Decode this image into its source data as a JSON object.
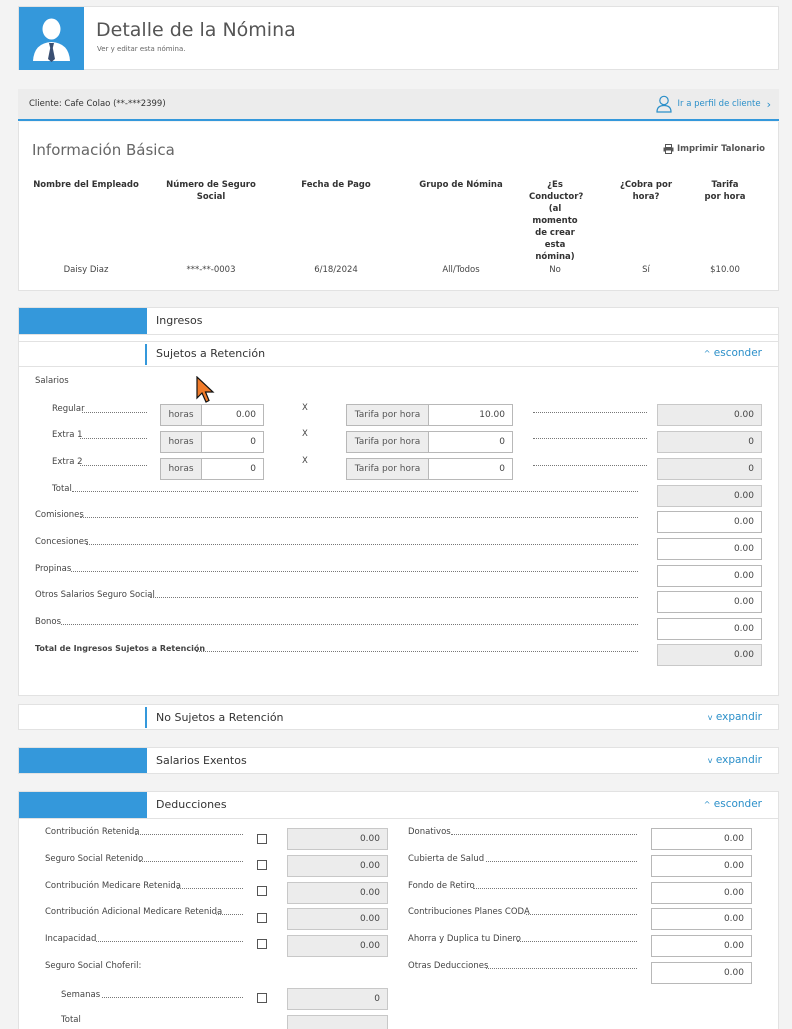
{
  "header": {
    "title": "Detalle de la Nómina",
    "subtitle": "Ver y editar esta nómina."
  },
  "client_bar": {
    "client_label": "Cliente: Cafe Colao (**-***2399)",
    "profile_link": "Ir a perfil de cliente"
  },
  "basic_info": {
    "title": "Información Básica",
    "print_label": "Imprimir Talonario",
    "columns": [
      "Nombre del Empleado",
      "Número de Seguro Social",
      "Fecha de Pago",
      "Grupo de Nómina",
      "¿Es Conductor? (al momento de crear esta nómina)",
      "¿Cobra por hora?",
      "Tarifa por hora"
    ],
    "row": [
      "Daisy Diaz",
      "***-**-0003",
      "6/18/2024",
      "All/Todos",
      "No",
      "Sí",
      "$10.00"
    ]
  },
  "sections": {
    "ingresos": "Ingresos",
    "sujetos": "Sujetos a Retención",
    "no_sujetos": "No Sujetos a Retención",
    "exentos": "Salarios Exentos",
    "deducciones": "Deducciones",
    "hide": "esconder",
    "expand": "expandir"
  },
  "salarios": {
    "label": "Salarios",
    "x": "X",
    "hours_addon": "horas",
    "rate_addon": "Tarifa por hora",
    "rows": [
      {
        "label": "Regular",
        "hours": "0.00",
        "rate": "10.00",
        "total": "0.00"
      },
      {
        "label": "Extra 1",
        "hours": "0",
        "rate": "0",
        "total": "0"
      },
      {
        "label": "Extra 2",
        "hours": "0",
        "rate": "0",
        "total": "0"
      }
    ],
    "total_label": "Total",
    "total_value": "0.00"
  },
  "other_income": [
    {
      "label": "Comisiones",
      "value": "0.00"
    },
    {
      "label": "Concesiones",
      "value": "0.00"
    },
    {
      "label": "Propinas",
      "value": "0.00"
    },
    {
      "label": "Otros Salarios Seguro Social",
      "value": "0.00"
    },
    {
      "label": "Bonos",
      "value": "0.00"
    }
  ],
  "total_ingresos": {
    "label": "Total de Ingresos Sujetos a Retención",
    "value": "0.00"
  },
  "deducciones_left": [
    {
      "label": "Contribución Retenida",
      "value": "0.00"
    },
    {
      "label": "Seguro Social Retenido",
      "value": "0.00"
    },
    {
      "label": "Contribución Medicare Retenida",
      "value": "0.00"
    },
    {
      "label": "Contribución Adicional Medicare Retenida",
      "value": "0.00"
    },
    {
      "label": "Incapacidad",
      "value": "0.00"
    }
  ],
  "choferil": {
    "label": "Seguro Social Choferil:",
    "semanas_label": "Semanas",
    "semanas_value": "0",
    "total_label": "Total"
  },
  "deducciones_right": [
    {
      "label": "Donativos",
      "value": "0.00"
    },
    {
      "label": "Cubierta de Salud",
      "value": "0.00"
    },
    {
      "label": "Fondo de Retiro",
      "value": "0.00"
    },
    {
      "label": "Contribuciones Planes CODA",
      "value": "0.00"
    },
    {
      "label": "Ahorra y Duplica tu Dinero",
      "value": "0.00"
    },
    {
      "label": "Otras Deducciones",
      "value": "0.00"
    }
  ]
}
